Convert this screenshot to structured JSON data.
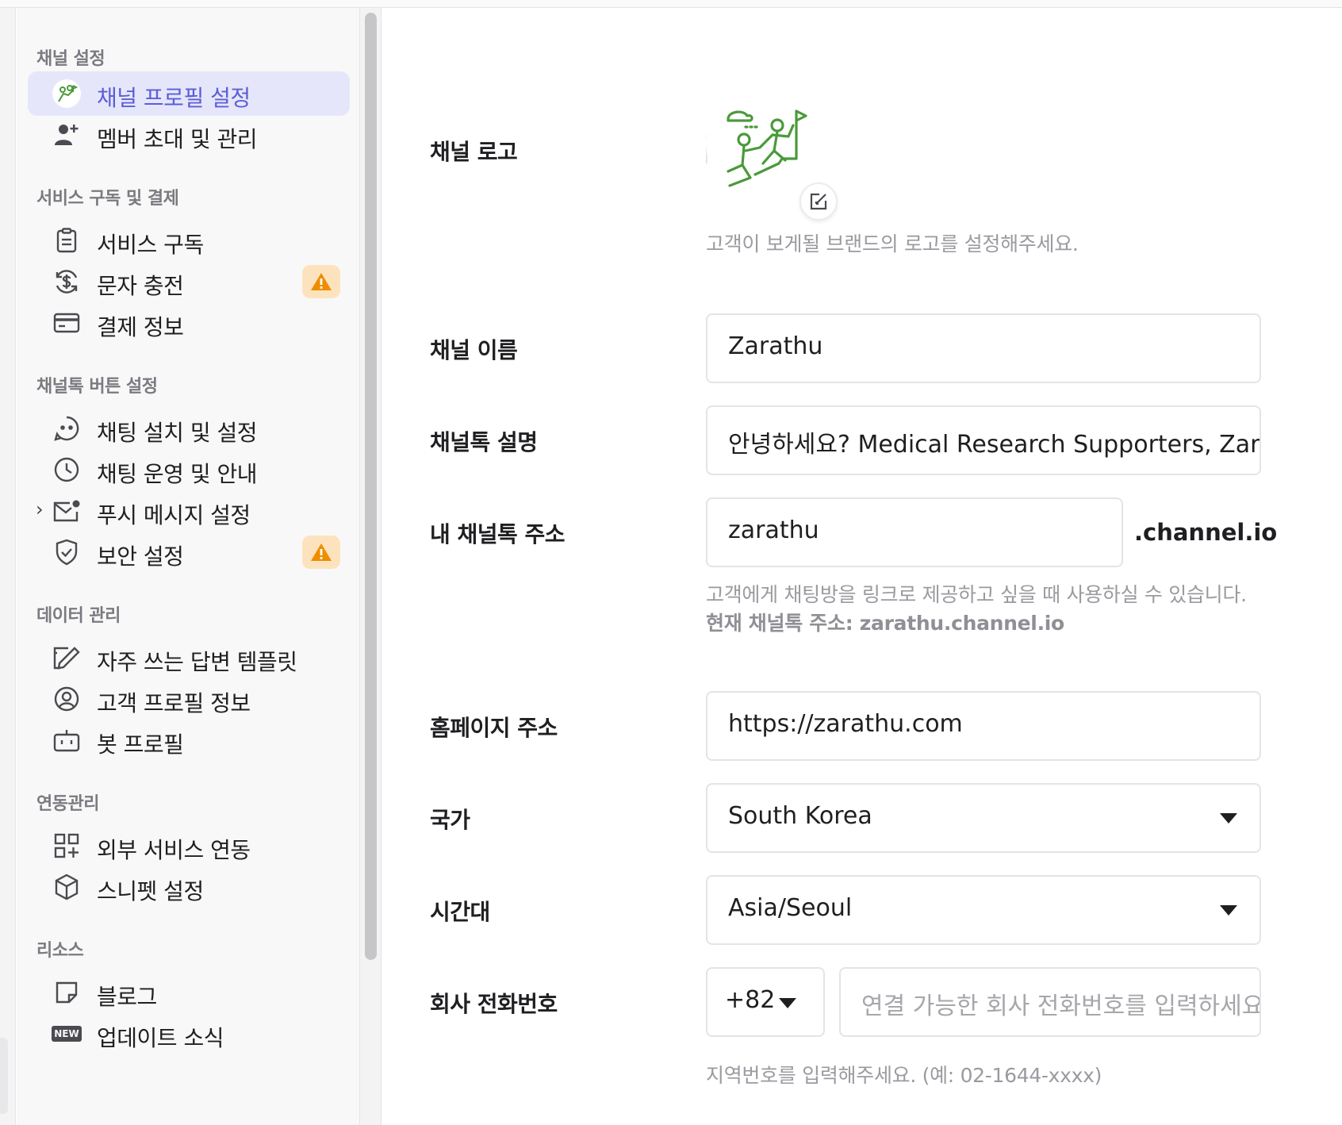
{
  "sidebar": {
    "sections": [
      {
        "title": "채널 설정"
      },
      {
        "title": "서비스 구독 및 결제"
      },
      {
        "title": "채널톡 버튼 설정"
      },
      {
        "title": "데이터 관리"
      },
      {
        "title": "연동관리"
      },
      {
        "title": "리소스"
      }
    ],
    "items": [
      {
        "label": "채널 프로필 설정",
        "icon": "channel-avatar-icon",
        "active": true
      },
      {
        "label": "멤버 초대 및 관리",
        "icon": "add-member-icon"
      },
      {
        "label": "서비스 구독",
        "icon": "clipboard-icon"
      },
      {
        "label": "문자 충전",
        "icon": "dollar-refresh-icon",
        "warning": true
      },
      {
        "label": "결제 정보",
        "icon": "credit-card-icon"
      },
      {
        "label": "채팅 설치 및 설정",
        "icon": "chat-face-icon"
      },
      {
        "label": "채팅 운영 및 안내",
        "icon": "clock-icon"
      },
      {
        "label": "푸시 메시지 설정",
        "icon": "mail-notification-icon"
      },
      {
        "label": "보안 설정",
        "icon": "shield-check-icon",
        "warning": true
      },
      {
        "label": "자주 쓰는 답변 템플릿",
        "icon": "template-edit-icon"
      },
      {
        "label": "고객 프로필 정보",
        "icon": "user-circle-icon"
      },
      {
        "label": "봇 프로필",
        "icon": "bot-icon"
      },
      {
        "label": "외부 서비스 연동",
        "icon": "grid-plus-icon"
      },
      {
        "label": "스니펫 설정",
        "icon": "cube-icon"
      },
      {
        "label": "블로그",
        "icon": "note-icon"
      },
      {
        "label": "업데이트 소식",
        "icon": "new-badge-icon"
      }
    ],
    "expand_chevron": "›",
    "new_badge_text": "NEW"
  },
  "form": {
    "logo": {
      "label": "채널 로고",
      "hint": "고객이 보게될 브랜드의 로고를 설정해주세요."
    },
    "name": {
      "label": "채널 이름",
      "value": "Zarathu"
    },
    "description": {
      "label": "채널톡 설명",
      "value": "안녕하세요? Medical Research Supporters, Zarathu 입니다."
    },
    "address": {
      "label": "내 채널톡 주소",
      "value": "zarathu",
      "suffix": ".channel.io",
      "hint": "고객에게 채팅방을 링크로 제공하고 싶을 때 사용하실 수 있습니다.",
      "current_label": "현재 채널톡 주소: zarathu.channel.io"
    },
    "homepage": {
      "label": "홈페이지 주소",
      "value": "https://zarathu.com"
    },
    "country": {
      "label": "국가",
      "value": "South Korea"
    },
    "timezone": {
      "label": "시간대",
      "value": "Asia/Seoul"
    },
    "phone": {
      "label": "회사 전화번호",
      "country_code": "+82",
      "placeholder": "연결 가능한 회사 전화번호를 입력하세요",
      "hint": "지역번호를 입력해주세요. (예: 02-1644-xxxx)"
    }
  },
  "colors": {
    "accent": "#5b5fd6",
    "active_bg": "#e6e6fb",
    "warning_bg": "#fde3bd",
    "warning_icon": "#f08c00",
    "logo_green": "#4a9a3a"
  }
}
